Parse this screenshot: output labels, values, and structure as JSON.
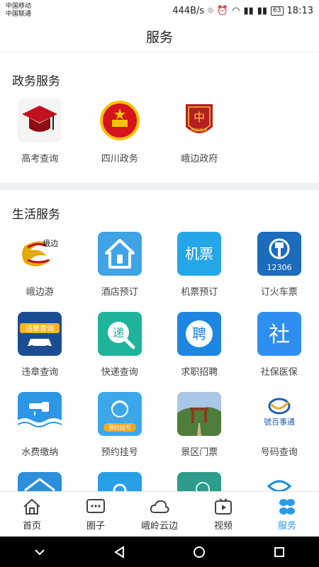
{
  "status_bar": {
    "carrier1": "中国移动",
    "carrier2": "中国联通",
    "speed": "444B/s",
    "battery": "63",
    "time": "18:13"
  },
  "header": {
    "title": "服务"
  },
  "gov_section": {
    "title": "政务服务",
    "items": [
      {
        "label": "高考查询",
        "icon": "graduation-cap-icon"
      },
      {
        "label": "四川政务",
        "icon": "national-emblem-icon"
      },
      {
        "label": "峨边政府",
        "icon": "tax-emblem-icon",
        "emblem_text": "税收税务"
      }
    ]
  },
  "life_section": {
    "title": "生活服务",
    "items": [
      {
        "label": "峨边游",
        "icon": "ebian-tour-icon",
        "icon_text": "峨边"
      },
      {
        "label": "酒店预订",
        "icon": "hotel-icon"
      },
      {
        "label": "机票预订",
        "icon": "flight-ticket-icon",
        "icon_text": "机票"
      },
      {
        "label": "订火车票",
        "icon": "railway-icon",
        "icon_text": "12306"
      },
      {
        "label": "违章查询",
        "icon": "traffic-violation-icon",
        "icon_text": "违章查询"
      },
      {
        "label": "快递查询",
        "icon": "express-icon",
        "icon_text": "递"
      },
      {
        "label": "求职招聘",
        "icon": "recruitment-icon",
        "icon_text": "聘"
      },
      {
        "label": "社保医保",
        "icon": "social-security-icon",
        "icon_text": "社"
      },
      {
        "label": "水费缴纳",
        "icon": "water-fee-icon"
      },
      {
        "label": "预约挂号",
        "icon": "appointment-icon",
        "icon_text": "预约挂号"
      },
      {
        "label": "景区门票",
        "icon": "scenic-ticket-icon"
      },
      {
        "label": "号码查询",
        "icon": "number-query-icon",
        "icon_text": "號百事通"
      }
    ]
  },
  "tabbar": {
    "tabs": [
      {
        "label": "首页",
        "icon": "home-icon"
      },
      {
        "label": "圈子",
        "icon": "chat-icon"
      },
      {
        "label": "峨岭云边",
        "icon": "cloud-icon"
      },
      {
        "label": "视频",
        "icon": "video-icon"
      },
      {
        "label": "服务",
        "icon": "service-icon",
        "active": true
      }
    ]
  },
  "colors": {
    "accent": "#2c9ae8",
    "divider": "#eef1f5"
  }
}
